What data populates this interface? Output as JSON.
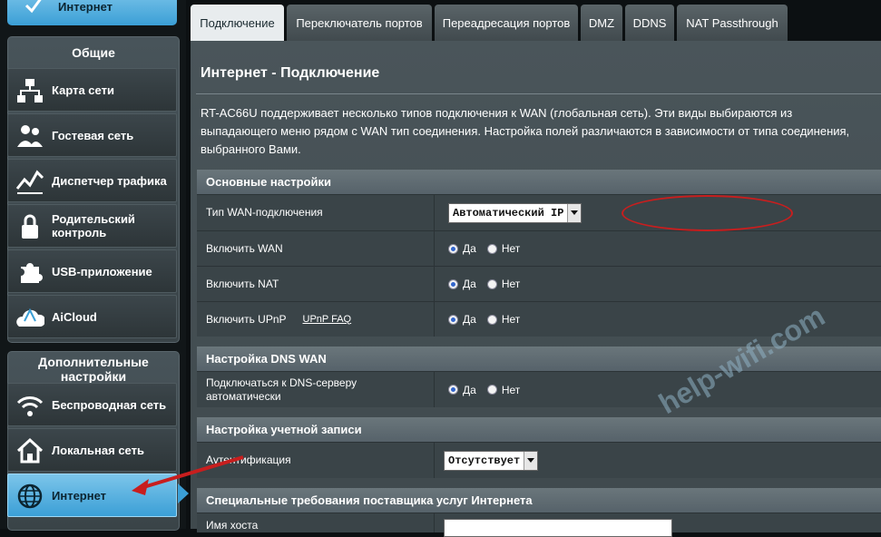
{
  "sidebar": {
    "top_item": "Интернет",
    "general_title": "Общие",
    "general_items": [
      {
        "label": "Карта сети",
        "icon": "network-map-icon"
      },
      {
        "label": "Гостевая сеть",
        "icon": "guest-network-icon"
      },
      {
        "label": "Диспетчер трафика",
        "icon": "traffic-manager-icon"
      },
      {
        "label": "Родительский контроль",
        "icon": "parental-control-icon"
      },
      {
        "label": "USB-приложение",
        "icon": "usb-app-icon"
      },
      {
        "label": "AiCloud",
        "icon": "aicloud-icon"
      }
    ],
    "advanced_title": "Дополнительные настройки",
    "advanced_items": [
      {
        "label": "Беспроводная сеть",
        "icon": "wireless-icon"
      },
      {
        "label": "Локальная сеть",
        "icon": "lan-home-icon"
      },
      {
        "label": "Интернет",
        "icon": "internet-globe-icon",
        "active": true
      }
    ]
  },
  "tabs": [
    {
      "label": "Подключение",
      "active": true
    },
    {
      "label": "Переключатель портов"
    },
    {
      "label": "Переадресация портов"
    },
    {
      "label": "DMZ"
    },
    {
      "label": "DDNS"
    },
    {
      "label": "NAT Passthrough"
    }
  ],
  "page": {
    "title": "Интернет - Подключение",
    "description": "RT-AC66U поддерживает несколько типов подключения к WAN (глобальная сеть). Эти виды выбираются из выпадающего меню рядом с WAN тип соединения. Настройка полей различаются в зависимости от типа соединения, выбранного Вами."
  },
  "basic": {
    "header": "Основные настройки",
    "wan_type_label": "Тип WAN-подключения",
    "wan_type_value": "Автоматический IP",
    "enable_wan_label": "Включить WAN",
    "enable_nat_label": "Включить NAT",
    "enable_upnp_label": "Включить UPnP",
    "upnp_faq": "UPnP FAQ",
    "yes": "Да",
    "no": "Нет"
  },
  "dns": {
    "header": "Настройка DNS WAN",
    "auto_label": "Подключаться к DNS-серверу автоматически"
  },
  "account": {
    "header": "Настройка учетной записи",
    "auth_label": "Аутентификация",
    "auth_value": "Отсутствует"
  },
  "isp": {
    "header": "Специальные требования поставщика услуг Интернета",
    "partial_label": "Имя хоста"
  },
  "watermark": "help-wifi.com",
  "colors": {
    "accent": "#3b9fd6",
    "highlight": "#c81e1e"
  }
}
